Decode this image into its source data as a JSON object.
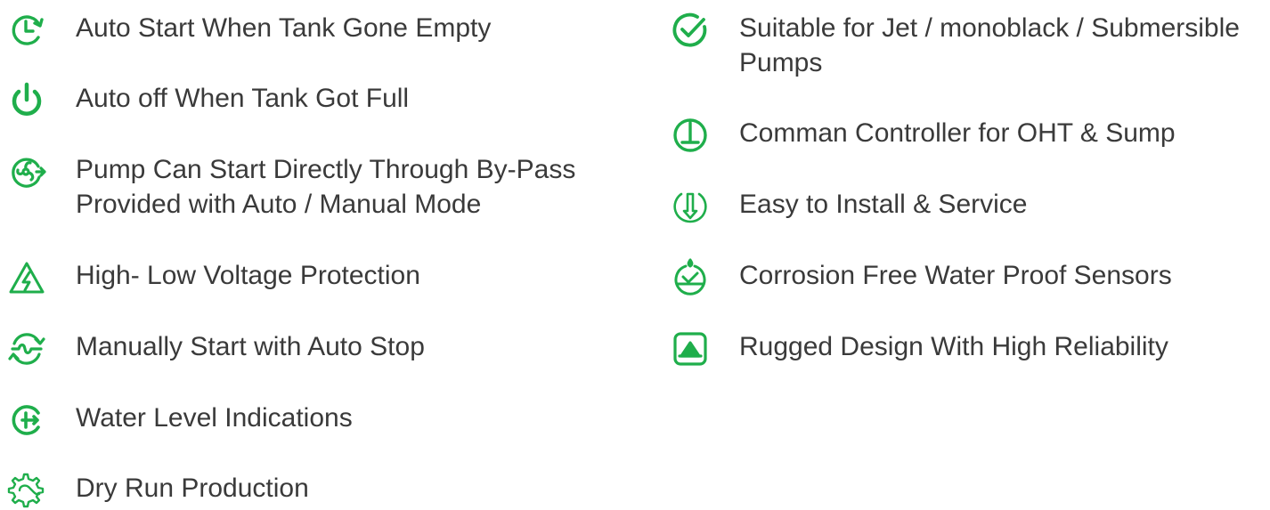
{
  "colors": {
    "accent": "#1fae4b",
    "text": "#3a3a3a"
  },
  "left_features": [
    {
      "icon": "clock-restart-icon",
      "text": "Auto Start When Tank Gone Empty"
    },
    {
      "icon": "power-icon",
      "text": "Auto off When Tank Got Full"
    },
    {
      "icon": "fan-bypass-icon",
      "text": "Pump Can Start Directly Through By-Pass\nProvided with Auto / Manual Mode"
    },
    {
      "icon": "voltage-warning-icon",
      "text": "High- Low Voltage Protection"
    },
    {
      "icon": "cycle-wave-icon",
      "text": "Manually Start with Auto Stop"
    },
    {
      "icon": "level-indicator-icon",
      "text": "Water Level Indications"
    },
    {
      "icon": "gear-pipe-icon",
      "text": "Dry Run Production"
    }
  ],
  "right_features": [
    {
      "icon": "check-circle-icon",
      "text": "Suitable for Jet / monoblack / Submersible\nPumps"
    },
    {
      "icon": "controller-icon",
      "text": "Comman Controller for OHT & Sump"
    },
    {
      "icon": "install-arrow-icon",
      "text": "Easy to Install & Service"
    },
    {
      "icon": "water-drop-check-icon",
      "text": "Corrosion Free Water Proof Sensors"
    },
    {
      "icon": "rugged-box-icon",
      "text": "Rugged Design With High Reliability"
    }
  ]
}
